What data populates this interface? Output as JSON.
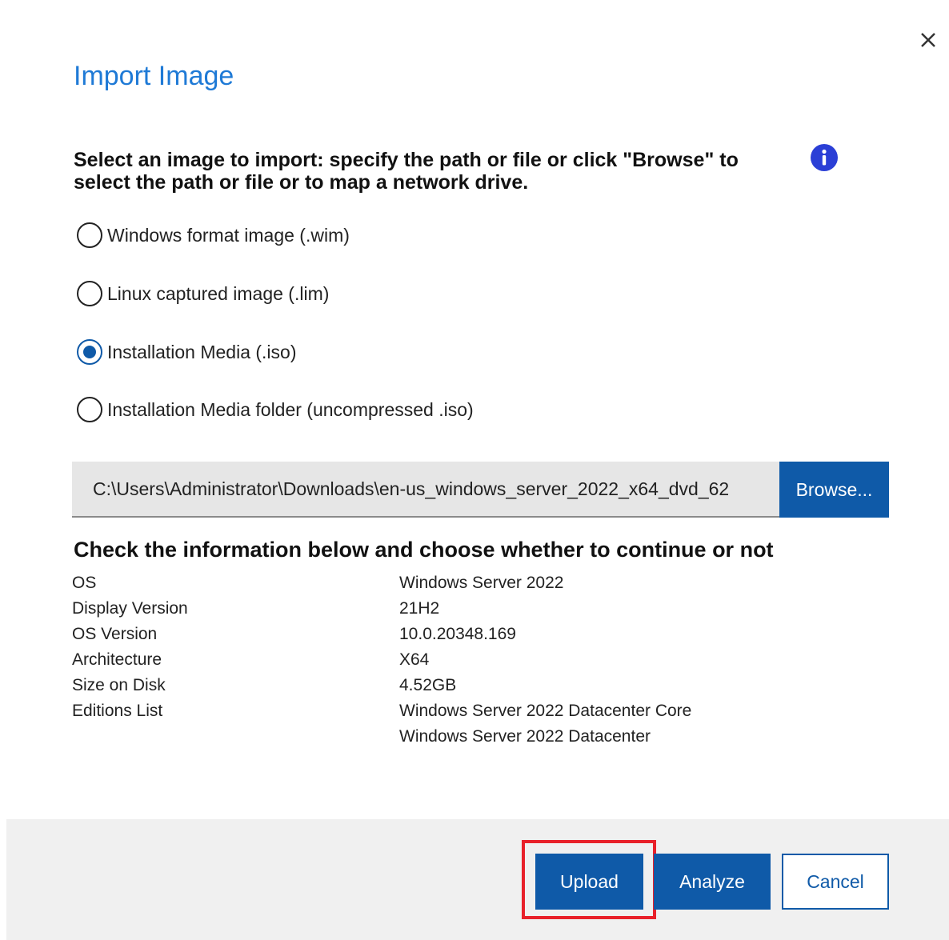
{
  "colors": {
    "accent": "#0f5aa8",
    "title": "#1f7ad6",
    "top_bar": "#1665b8",
    "highlight": "#e8202a",
    "footer_bg": "#f0f0f0",
    "input_bg": "#e6e6e6"
  },
  "dialog": {
    "title": "Import Image",
    "close_icon": "close-icon",
    "instructions": "Select an image to import: specify the path or file or click \"Browse\" to select the path or file or to map a network drive.",
    "info_icon": "info-icon"
  },
  "image_types": {
    "selected": "Installation Media (.iso)",
    "options": [
      {
        "label": "Windows format image (.wim)",
        "checked": false
      },
      {
        "label": "Linux captured image (.lim)",
        "checked": false
      },
      {
        "label": "Installation Media (.iso)",
        "checked": true
      },
      {
        "label": "Installation Media folder (uncompressed .iso)",
        "checked": false
      }
    ]
  },
  "path": {
    "value": "C:\\Users\\Administrator\\Downloads\\en-us_windows_server_2022_x64_dvd_62",
    "browse_label": "Browse..."
  },
  "check_info": {
    "heading": "Check the information below and choose whether to continue or not",
    "rows": [
      {
        "key": "OS",
        "value": "Windows Server 2022"
      },
      {
        "key": "Display Version",
        "value": "21H2"
      },
      {
        "key": "OS Version",
        "value": "10.0.20348.169"
      },
      {
        "key": "Architecture",
        "value": "X64"
      },
      {
        "key": "Size on Disk",
        "value": "4.52GB"
      }
    ],
    "editions_label": "Editions List",
    "editions": [
      "Windows Server 2022 Datacenter Core",
      "Windows Server 2022 Datacenter"
    ]
  },
  "footer": {
    "upload_label": "Upload",
    "analyze_label": "Analyze",
    "cancel_label": "Cancel",
    "upload_highlighted": true
  }
}
